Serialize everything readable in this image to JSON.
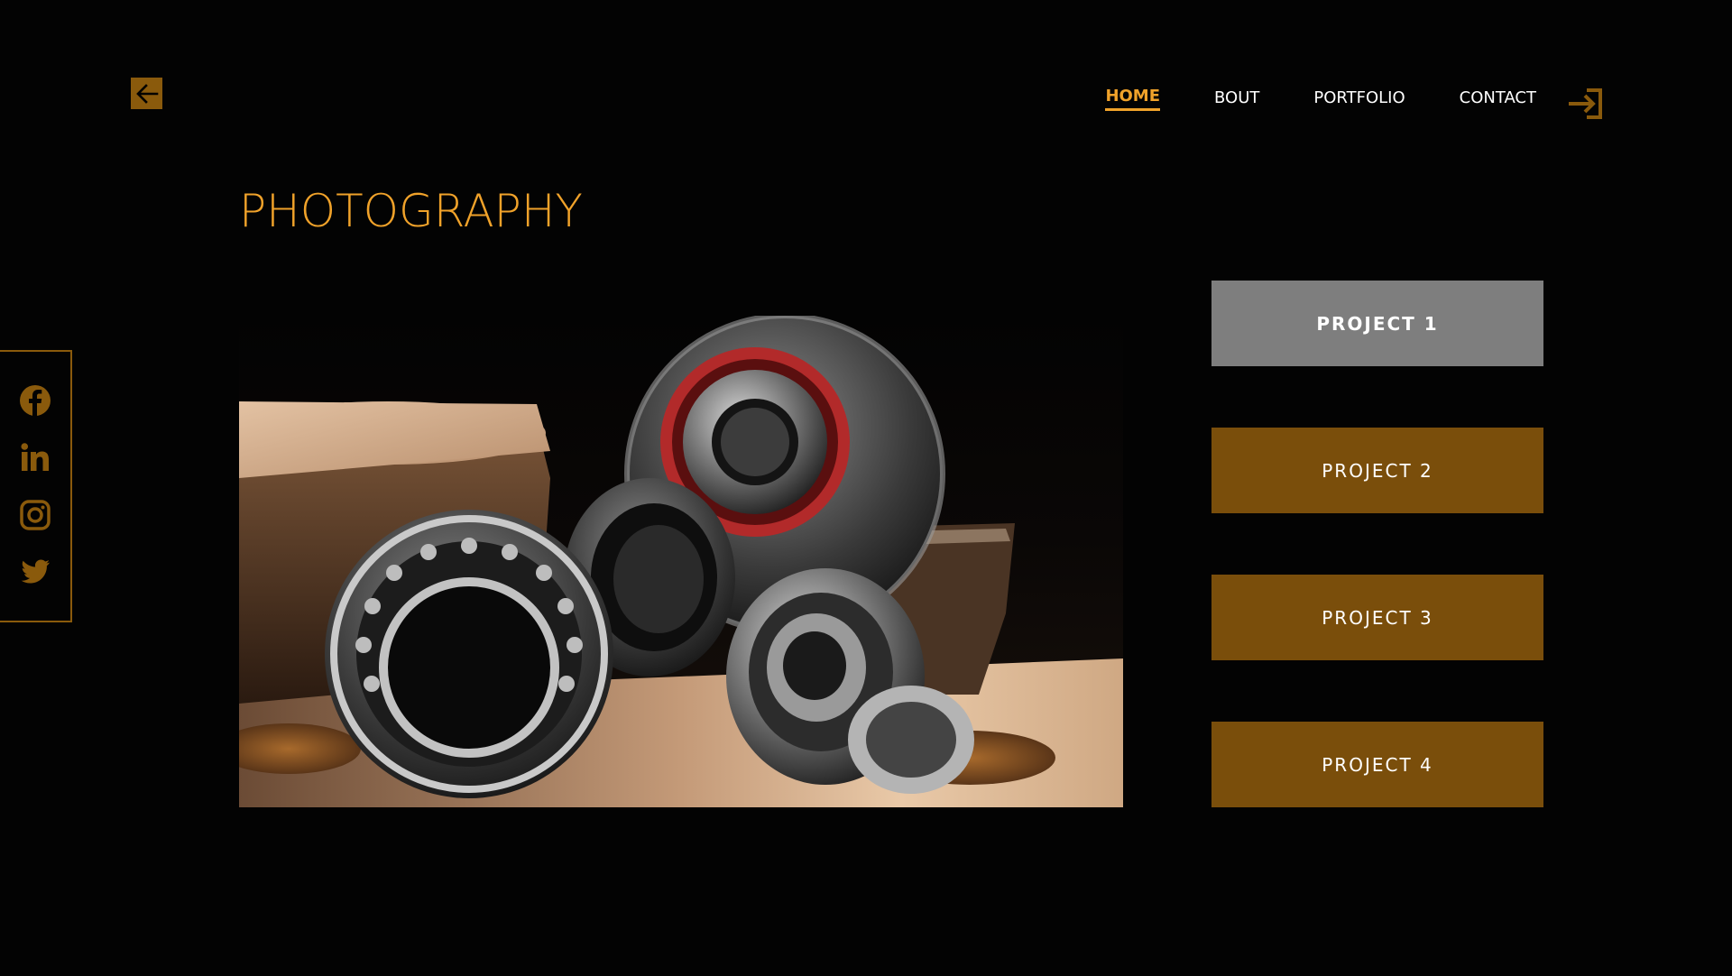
{
  "nav": {
    "items": [
      {
        "label": "HOME",
        "active": true
      },
      {
        "label": "BOUT",
        "active": false
      },
      {
        "label": "PORTFOLIO",
        "active": false
      },
      {
        "label": "CONTACT",
        "active": false
      }
    ]
  },
  "page": {
    "title": "PHOTOGRAPHY"
  },
  "icons": {
    "back": "arrow-left-icon",
    "login": "login-icon",
    "social": [
      "facebook-icon",
      "linkedin-icon",
      "instagram-icon",
      "twitter-icon"
    ]
  },
  "projects": [
    {
      "label": "PROJECT 1",
      "selected": true
    },
    {
      "label": "PROJECT 2",
      "selected": false
    },
    {
      "label": "PROJECT 3",
      "selected": false
    },
    {
      "label": "PROJECT 4",
      "selected": false
    }
  ],
  "colors": {
    "background": "#030303",
    "accent": "#f0a22a",
    "accent_dark": "#7a4e0b",
    "selected_button": "#7e7e7e",
    "text": "#ffffff"
  }
}
